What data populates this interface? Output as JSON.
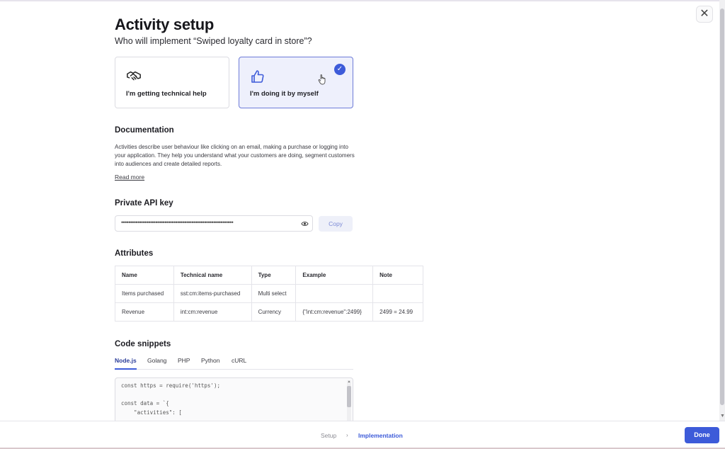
{
  "header": {
    "title": "Activity setup",
    "subtitle": "Who will implement “Swiped loyalty card in store”?",
    "close_icon": "close-icon"
  },
  "options": [
    {
      "label": "I'm getting technical help",
      "icon": "handshake-icon",
      "selected": false
    },
    {
      "label": "I'm doing it by myself",
      "icon": "thumbs-up-icon",
      "selected": true
    }
  ],
  "documentation": {
    "heading": "Documentation",
    "text": "Activities describe user behaviour like clicking on an email, making a purchase or logging into your application. They help you understand what your customers are doing, segment customers into audiences and create detailed reports.",
    "read_more": "Read more"
  },
  "api_key": {
    "heading": "Private API key",
    "masked_value": "••••••••••••••••••••••••••••••••••••••••••••••••••••••••••••••",
    "copy_label": "Copy"
  },
  "attributes": {
    "heading": "Attributes",
    "columns": [
      "Name",
      "Technical name",
      "Type",
      "Example",
      "Note"
    ],
    "rows": [
      [
        "Items purchased",
        "sst:cm:items-purchased",
        "Multi select",
        "",
        ""
      ],
      [
        "Revenue",
        "int:cm:revenue",
        "Currency",
        "{\"int:cm:revenue\":2499}",
        "2499 = 24.99"
      ]
    ]
  },
  "code_snippets": {
    "heading": "Code snippets",
    "tabs": [
      "Node.js",
      "Golang",
      "PHP",
      "Python",
      "cURL"
    ],
    "active_tab": "Node.js",
    "lines": [
      "const https = require('https');",
      "",
      "const data = `{",
      "    \"activities\": ["
    ]
  },
  "footer": {
    "steps": [
      "Setup",
      "Implementation"
    ],
    "separator": "›",
    "active_step": "Implementation",
    "done_label": "Done"
  },
  "colors": {
    "accent": "#3d5bd9",
    "selected_card_bg": "#eef0fc"
  }
}
